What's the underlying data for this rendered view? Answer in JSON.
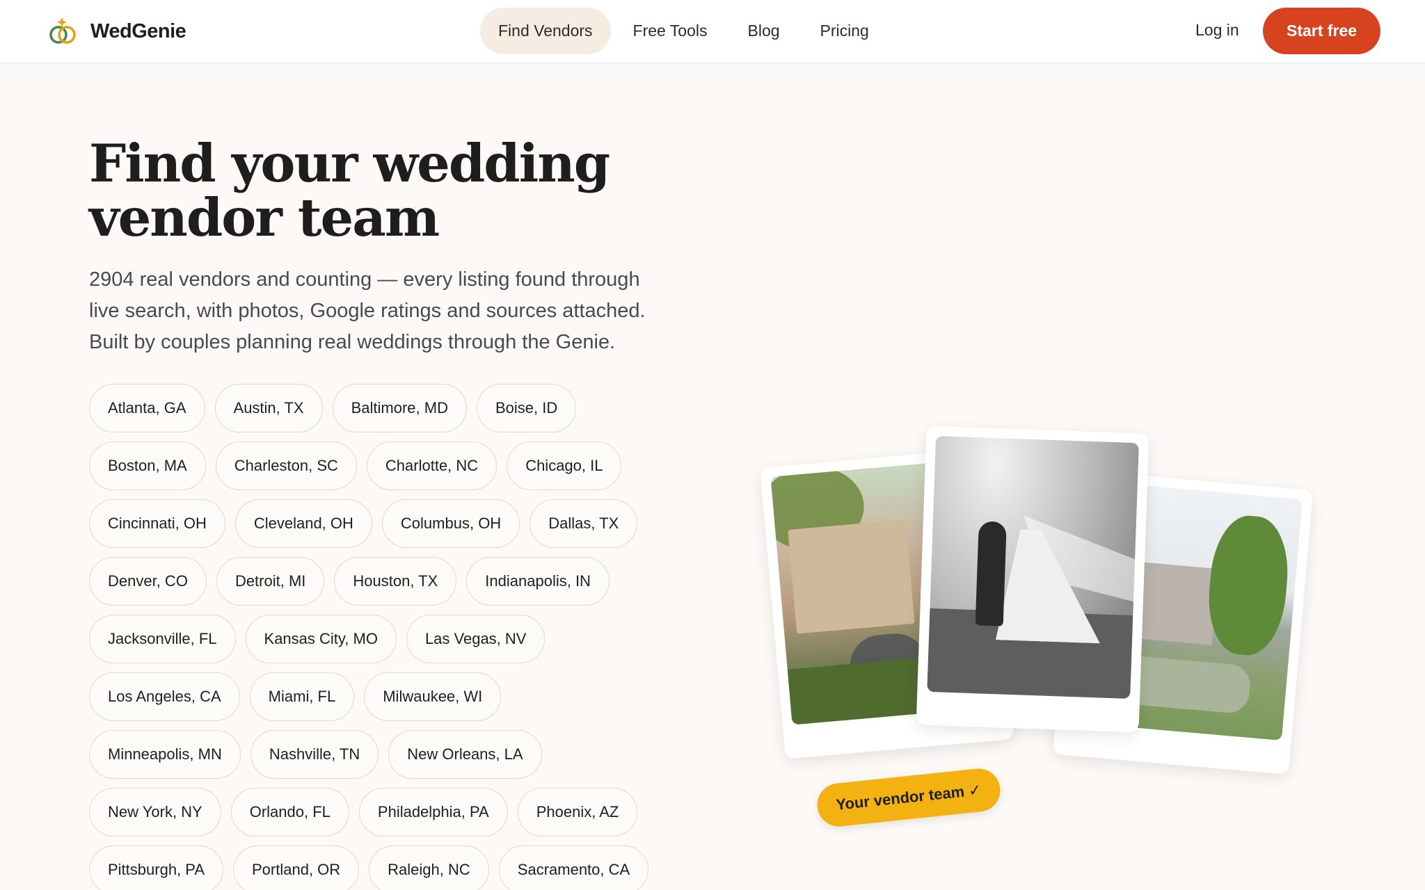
{
  "brand": {
    "name": "WedGenie"
  },
  "nav": {
    "items": [
      {
        "label": "Find Vendors",
        "active": true
      },
      {
        "label": "Free Tools",
        "active": false
      },
      {
        "label": "Blog",
        "active": false
      },
      {
        "label": "Pricing",
        "active": false
      }
    ],
    "login_label": "Log in",
    "cta_label": "Start free"
  },
  "hero": {
    "title_line1": "Find your wedding",
    "title_line2": "vendor team",
    "subtitle_line1": "2904 real vendors and counting — every listing found through",
    "subtitle_line2": "live search, with photos, Google ratings and sources attached.",
    "subtitle_line3": "Built by couples planning real weddings through the Genie."
  },
  "cities": [
    [
      "Atlanta, GA",
      "Austin, TX",
      "Baltimore, MD",
      "Boise, ID"
    ],
    [
      "Boston, MA",
      "Charleston, SC",
      "Charlotte, NC",
      "Chicago, IL"
    ],
    [
      "Cincinnati, OH",
      "Cleveland, OH",
      "Columbus, OH",
      "Dallas, TX"
    ],
    [
      "Denver, CO",
      "Detroit, MI",
      "Houston, TX",
      "Indianapolis, IN"
    ],
    [
      "Jacksonville, FL",
      "Kansas City, MO",
      "Las Vegas, NV"
    ],
    [
      "Los Angeles, CA",
      "Miami, FL",
      "Milwaukee, WI"
    ],
    [
      "Minneapolis, MN",
      "Nashville, TN",
      "New Orleans, LA"
    ],
    [
      "New York, NY",
      "Orlando, FL",
      "Philadelphia, PA",
      "Phoenix, AZ"
    ],
    [
      "Pittsburgh, PA",
      "Portland, OR",
      "Raleigh, NC",
      "Sacramento, CA"
    ]
  ],
  "photo_badge": "Your vendor team ✓",
  "colors": {
    "accent": "#d8431f",
    "badge": "#f3b212",
    "nav_active_bg": "#f7ece1",
    "page_bg": "#fcf9f6"
  }
}
